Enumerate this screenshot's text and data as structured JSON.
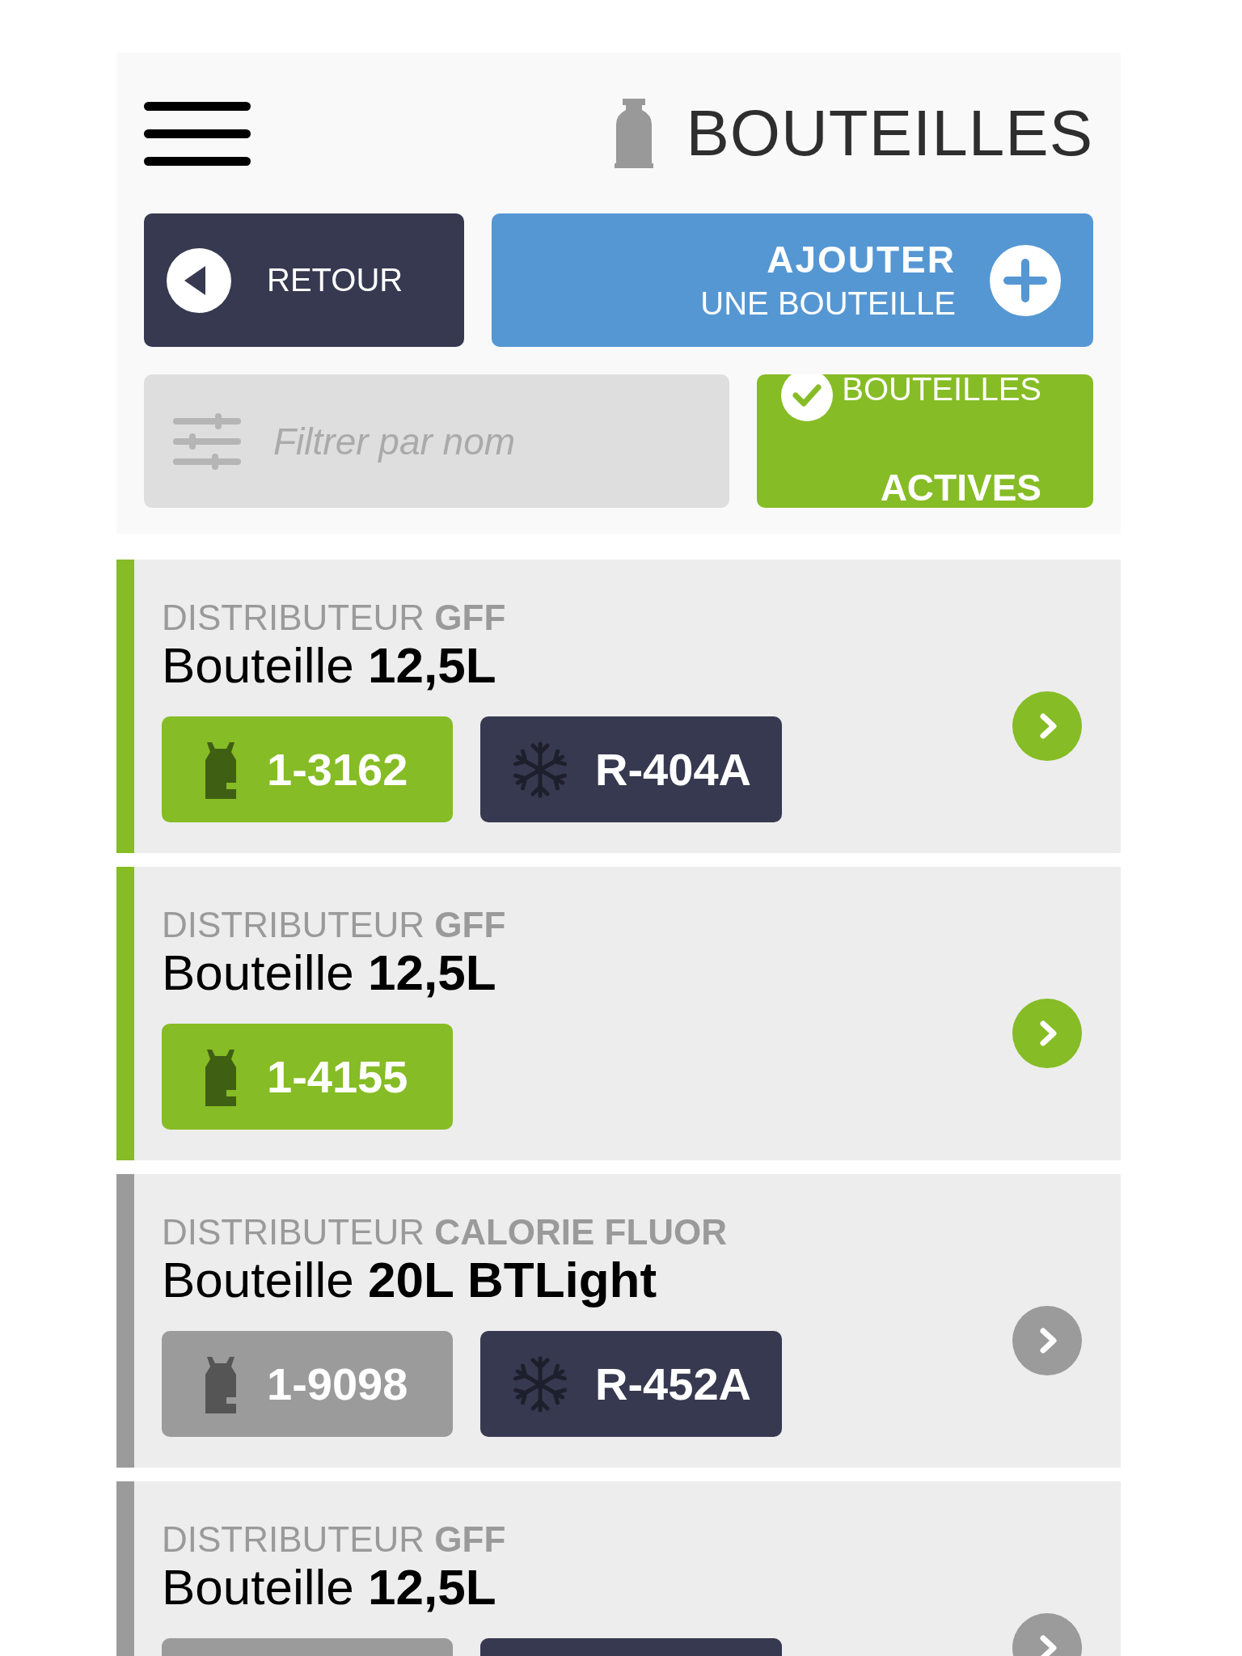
{
  "header": {
    "title": "BOUTEILLES"
  },
  "actions": {
    "back": "RETOUR",
    "add_line_1": "AJOUTER",
    "add_line_2": "UNE BOUTEILLE"
  },
  "filter": {
    "placeholder": "Filtrer par nom"
  },
  "active_toggle": {
    "line_1": "BOUTEILLES",
    "line_2": "ACTIVES",
    "checked": true
  },
  "bottles": [
    {
      "distributor": "DISTRIBUTEUR **GFF**",
      "name": "Bouteille **12,5L**",
      "active": true,
      "tags": [
        {
          "kind": "serial",
          "label": "1-3162"
        },
        {
          "kind": "gas",
          "label": "R-404A"
        }
      ]
    },
    {
      "distributor": "DISTRIBUTEUR **GFF**",
      "name": "Bouteille **12,5L**",
      "active": true,
      "tags": [
        {
          "kind": "serial",
          "label": "1-4155"
        }
      ]
    },
    {
      "distributor": "DISTRIBUTEUR **CALORIE FLUOR**",
      "name": "Bouteille **20L BTLight**",
      "active": false,
      "tags": [
        {
          "kind": "serial",
          "label": "1-9098"
        },
        {
          "kind": "gas",
          "label": "R-452A"
        }
      ]
    },
    {
      "distributor": "DISTRIBUTEUR **GFF**",
      "name": "Bouteille **12,5L**",
      "active": false,
      "tags": [
        {
          "kind": "serial"
        },
        {
          "kind": "gas"
        }
      ]
    }
  ]
}
